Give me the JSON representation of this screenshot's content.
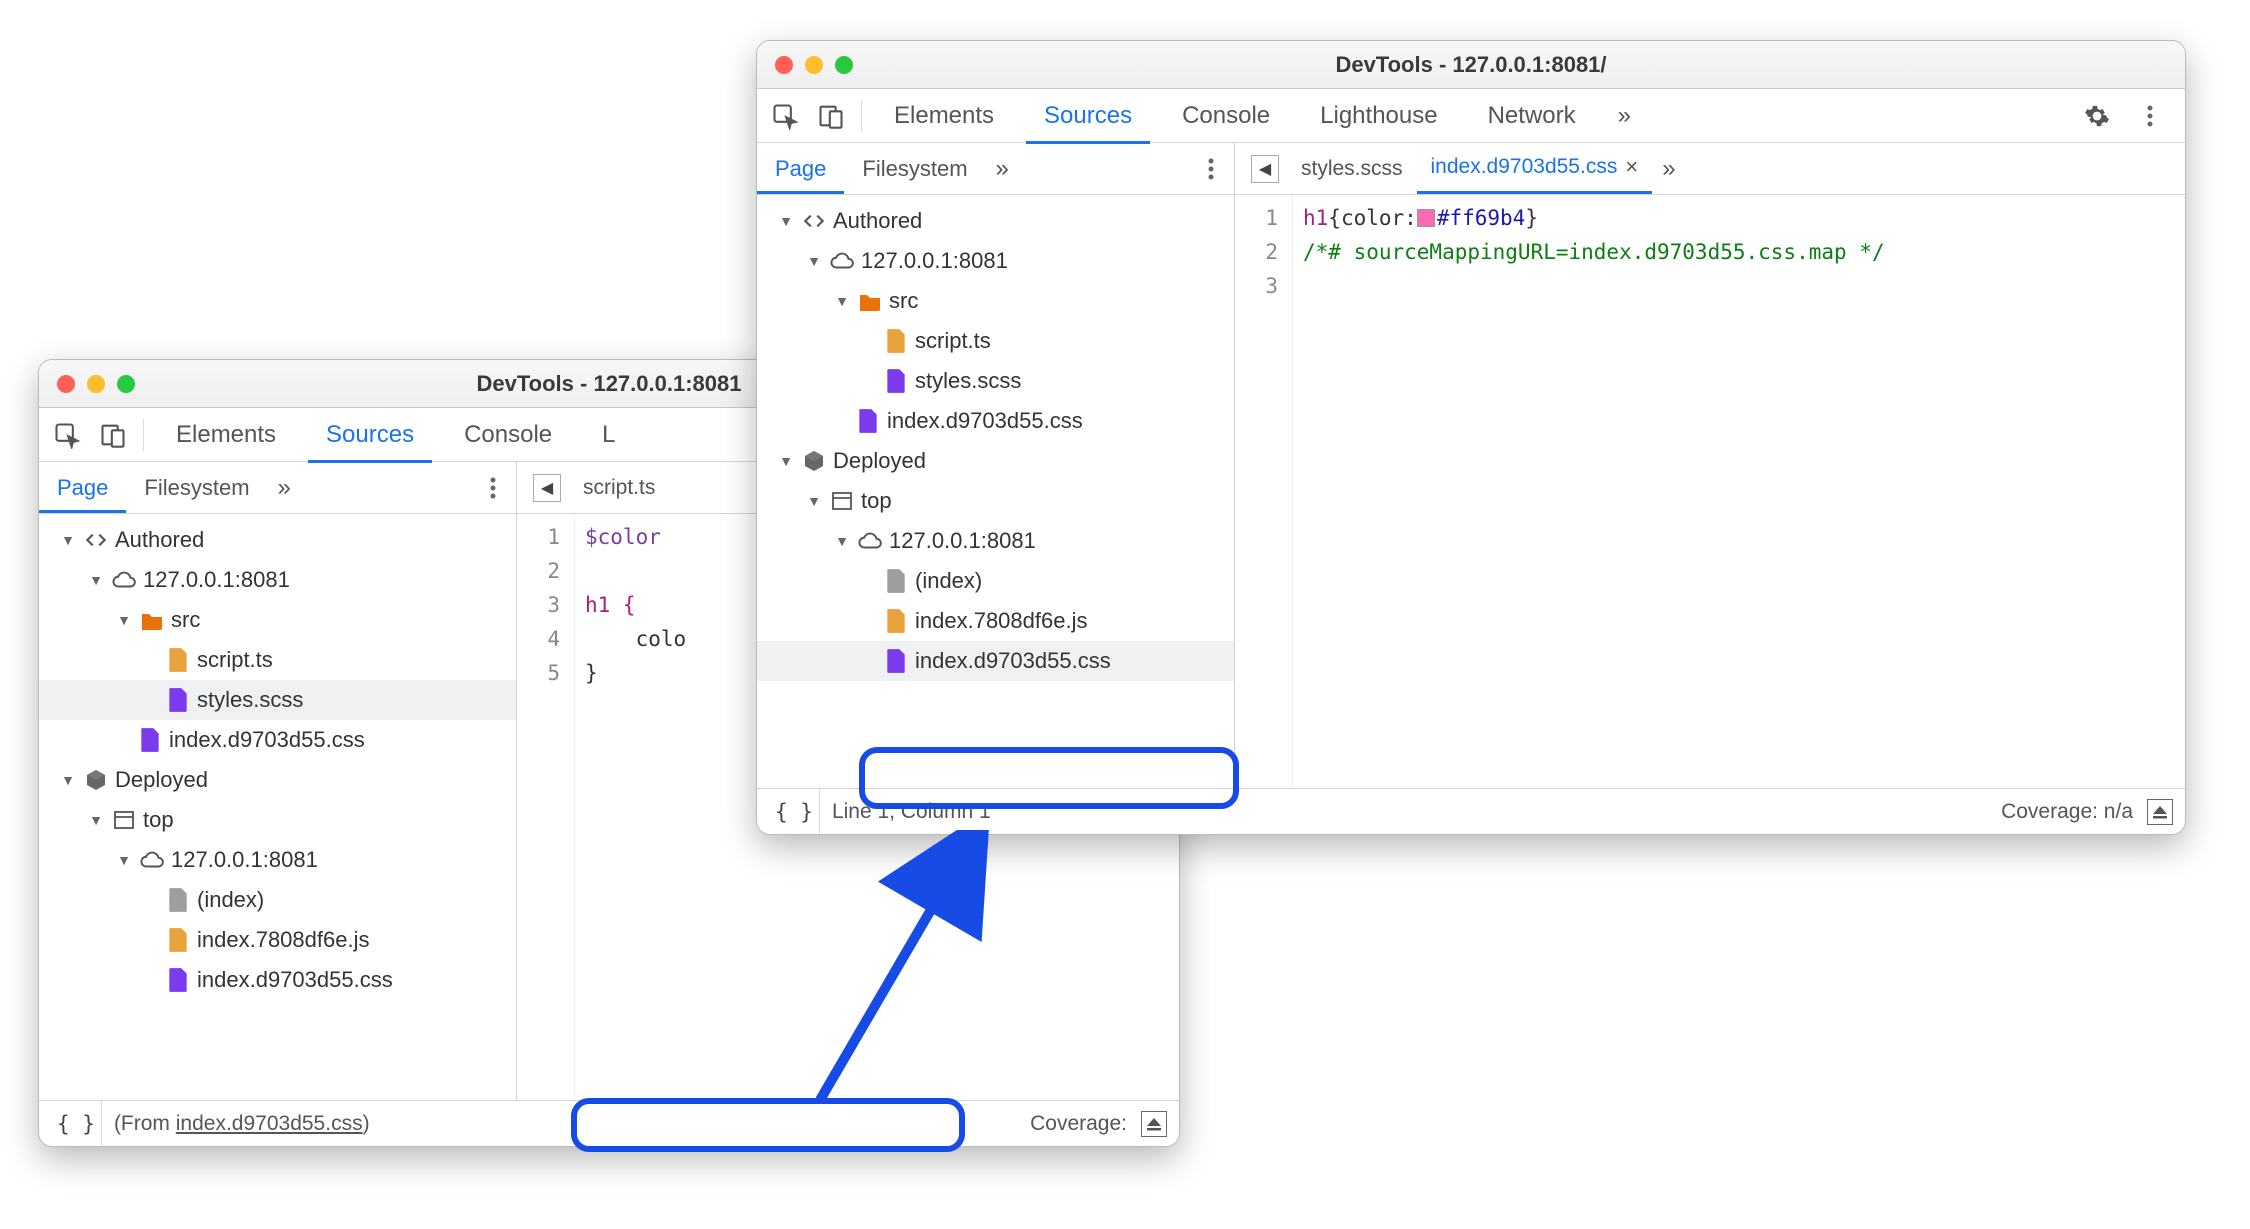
{
  "window1": {
    "title": "DevTools - 127.0.0.1:8081",
    "tabs": [
      "Elements",
      "Sources",
      "Console",
      "L"
    ],
    "active_tab": "Sources",
    "subtabs": [
      "Page",
      "Filesystem"
    ],
    "active_subtab": "Page",
    "open_file_tab": "script.ts",
    "tree": {
      "authored": "Authored",
      "host": "127.0.0.1:8081",
      "src": "src",
      "script": "script.ts",
      "styles": "styles.scss",
      "index_css": "index.d9703d55.css",
      "deployed": "Deployed",
      "top": "top",
      "host2": "127.0.0.1:8081",
      "index": "(index)",
      "index_js": "index.7808df6e.js",
      "index_css2": "index.d9703d55.css"
    },
    "gutter": [
      "1",
      "2",
      "3",
      "4",
      "5"
    ],
    "code_l1": "$color",
    "code_l3": "h1 {",
    "code_l4": "    colo",
    "code_l5": "}",
    "status_from_prefix": "(From ",
    "status_from_file": "index.d9703d55.css",
    "status_from_suffix": ")",
    "status_coverage": "Coverage:"
  },
  "window2": {
    "title": "DevTools - 127.0.0.1:8081/",
    "tabs": [
      "Elements",
      "Sources",
      "Console",
      "Lighthouse",
      "Network"
    ],
    "active_tab": "Sources",
    "subtabs": [
      "Page",
      "Filesystem"
    ],
    "active_subtab": "Page",
    "file_tab1": "styles.scss",
    "file_tab2": "index.d9703d55.css",
    "tree": {
      "authored": "Authored",
      "host": "127.0.0.1:8081",
      "src": "src",
      "script": "script.ts",
      "styles": "styles.scss",
      "index_css": "index.d9703d55.css",
      "deployed": "Deployed",
      "top": "top",
      "host2": "127.0.0.1:8081",
      "index": "(index)",
      "index_js": "index.7808df6e.js",
      "index_css2": "index.d9703d55.css"
    },
    "gutter": [
      "1",
      "2",
      "3"
    ],
    "code_seg1": "h1",
    "code_seg2": "{",
    "code_seg3": "color",
    "code_seg4": ":",
    "code_seg5": "#ff69b4",
    "code_seg6": "}",
    "code_comment": "/*# sourceMappingURL=index.d9703d55.css.map */",
    "status_line": "Line 1, Column 1",
    "status_coverage": "Coverage: n/a"
  }
}
